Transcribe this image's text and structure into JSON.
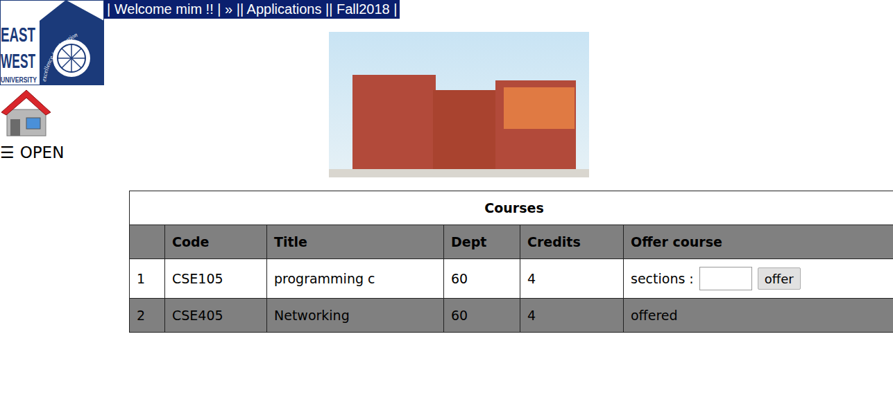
{
  "logo": {
    "lines": [
      "EAST",
      "WEST",
      "UNIVERSITY"
    ],
    "motto": "excellence in education"
  },
  "nav": {
    "text": "| Welcome mim !! | » || Applications || Fall2018 |"
  },
  "menu": {
    "icon": "☰",
    "label": "OPEN"
  },
  "table": {
    "caption": "Courses",
    "columns": [
      "",
      "Code",
      "Title",
      "Dept",
      "Credits",
      "Offer course"
    ],
    "rows": [
      {
        "index": "1",
        "code": "CSE105",
        "title": "programming c",
        "dept": "60",
        "credits": "4",
        "offered": false,
        "label": "sections :",
        "value": "",
        "button": "offer"
      },
      {
        "index": "2",
        "code": "CSE405",
        "title": "Networking",
        "dept": "60",
        "credits": "4",
        "offered": true,
        "status": "offered"
      }
    ]
  }
}
